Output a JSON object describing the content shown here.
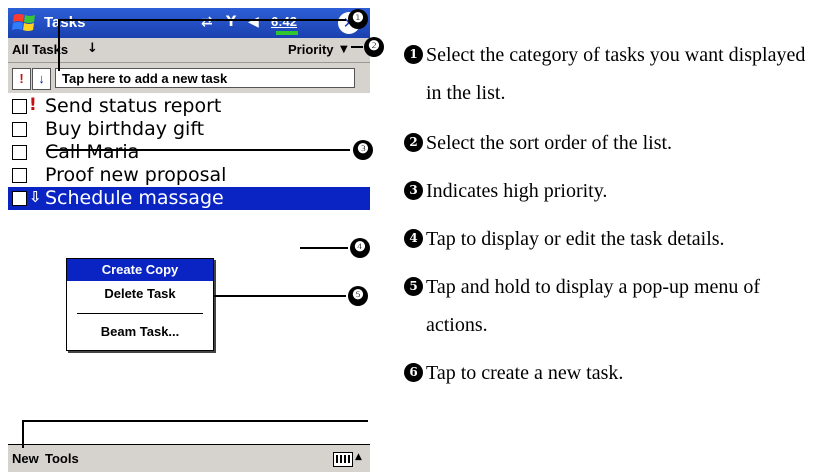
{
  "app": {
    "title": "Tasks",
    "clock": "6:42",
    "close_glyph": "✕",
    "status_icons": [
      "connectivity-icon",
      "signal-off-icon",
      "volume-icon"
    ]
  },
  "filter": {
    "label": "All Tasks",
    "arrow": "↓"
  },
  "sort": {
    "label": "Priority",
    "arrow": "▼"
  },
  "entry_bar": {
    "high_priority_button": "!",
    "low_priority_button": "↓",
    "placeholder": "Tap here to add a new task"
  },
  "tasks": [
    {
      "label": "Send status report",
      "priority": "!",
      "selected": false
    },
    {
      "label": "Buy birthday gift",
      "priority": "",
      "selected": false
    },
    {
      "label": "Call Maria",
      "priority": "",
      "selected": false
    },
    {
      "label": "Proof new proposal",
      "priority": "",
      "selected": false
    },
    {
      "label": "Schedule massage",
      "priority": "⇩",
      "selected": true
    }
  ],
  "context_menu": {
    "items": [
      "Create Copy",
      "Delete Task",
      "Beam Task..."
    ],
    "highlighted": "Create Copy"
  },
  "menu_bar": {
    "new": "New",
    "tools": "Tools",
    "input_arrow": "▲"
  },
  "callout_markers": [
    "❶",
    "❷",
    "❸",
    "❹",
    "❺",
    "❻"
  ],
  "descriptions": [
    {
      "num": "1",
      "text": "Select the category of tasks you want displayed in the list."
    },
    {
      "num": "2",
      "text": "Select the sort order of the list."
    },
    {
      "num": "3",
      "text": "Indicates high priority."
    },
    {
      "num": "4",
      "text": "Tap to display or edit the task details."
    },
    {
      "num": "5",
      "text": "Tap and hold to display a pop-up menu of actions."
    },
    {
      "num": "6",
      "text": "Tap to create a new task."
    }
  ]
}
